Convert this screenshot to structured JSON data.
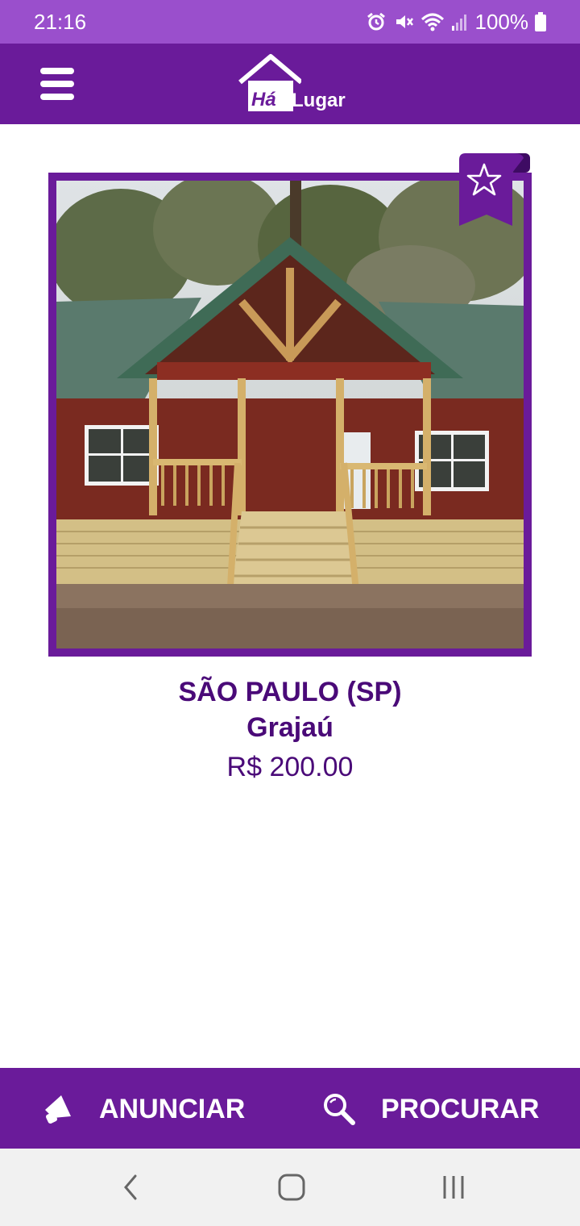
{
  "status_bar": {
    "time": "21:16",
    "battery": "100%",
    "icons": [
      "alarm-icon",
      "mute-icon",
      "wifi-icon",
      "signal-icon",
      "battery-icon"
    ]
  },
  "header": {
    "menu_icon": "hamburger-menu-icon",
    "logo_word_1": "Há",
    "logo_word_2": "Lugar"
  },
  "listing": {
    "favorite_icon": "star-outline-icon",
    "city": "SÃO PAULO (SP)",
    "neighborhood": "Grajaú",
    "price": "R$ 200.00"
  },
  "bottom_actions": {
    "advertise_label": "ANUNCIAR",
    "advertise_icon": "megaphone-icon",
    "search_label": "PROCURAR",
    "search_icon": "search-icon"
  },
  "nav": {
    "back_icon": "back-icon",
    "home_icon": "home-icon",
    "recents_icon": "recents-icon"
  },
  "colors": {
    "status_bar": "#9a4fcc",
    "primary": "#6a1b9a",
    "text": "#4a0a78"
  }
}
